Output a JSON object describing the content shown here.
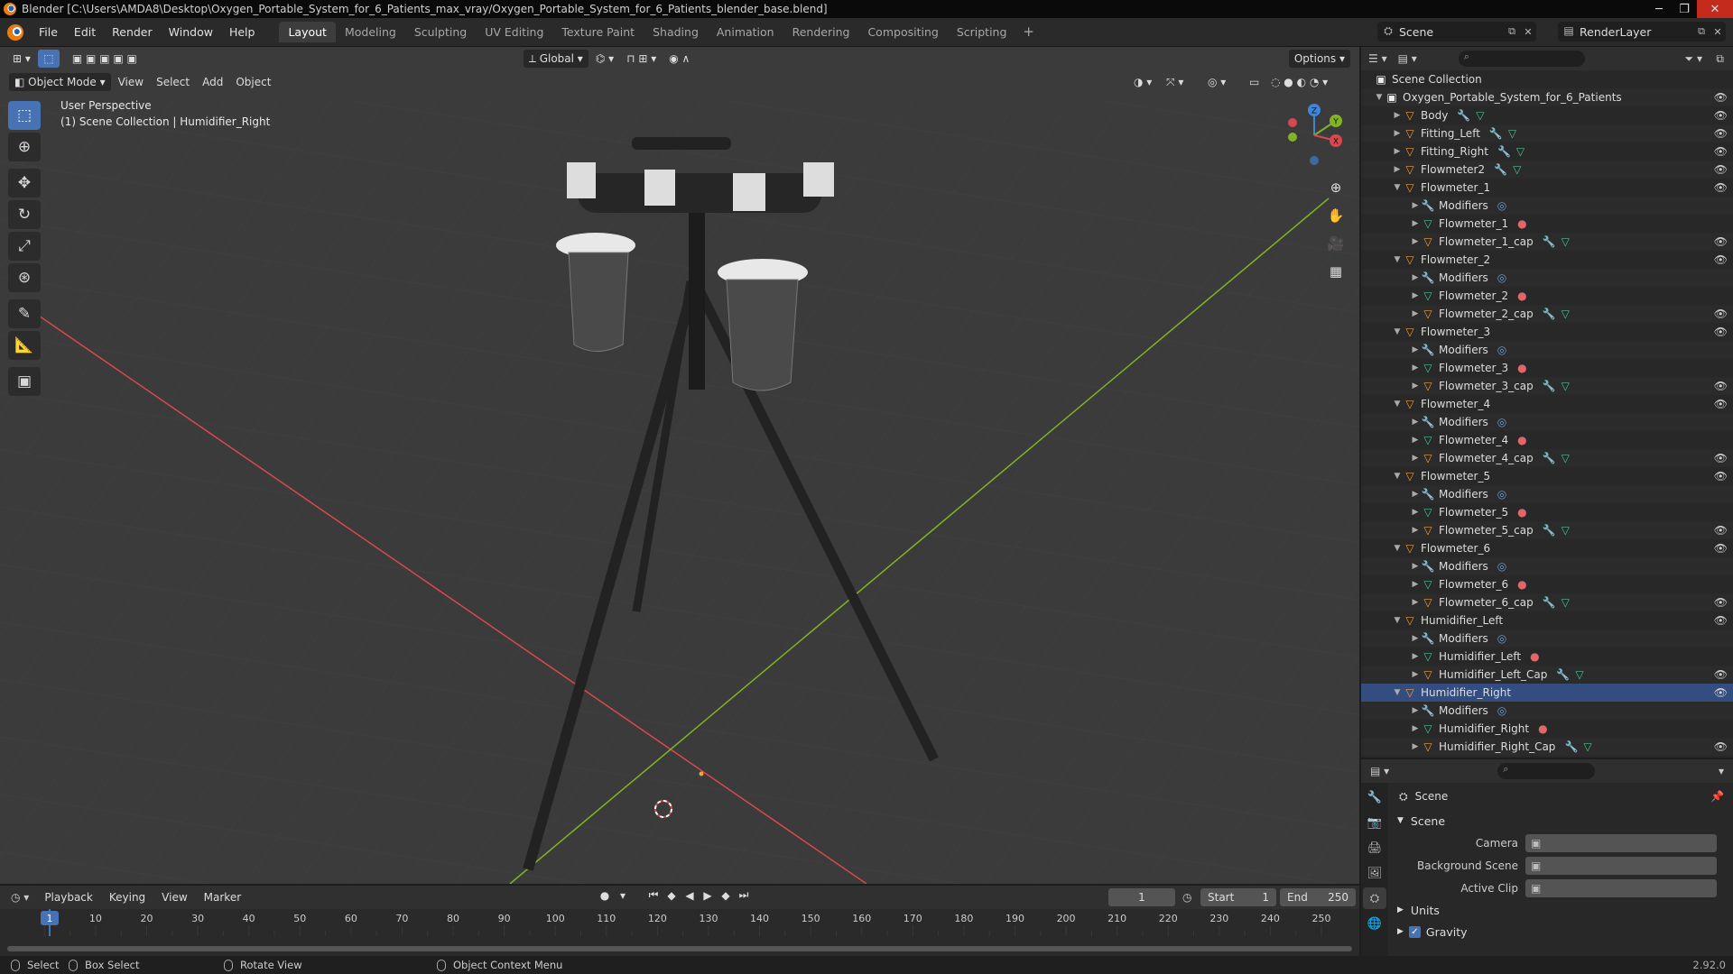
{
  "window": {
    "title": "Blender [C:\\Users\\AMDA8\\Desktop\\Oxygen_Portable_System_for_6_Patients_max_vray/Oxygen_Portable_System_for_6_Patients_blender_base.blend]"
  },
  "menubar": {
    "items": [
      "File",
      "Edit",
      "Render",
      "Window",
      "Help"
    ],
    "workspaces": [
      "Layout",
      "Modeling",
      "Sculpting",
      "UV Editing",
      "Texture Paint",
      "Shading",
      "Animation",
      "Rendering",
      "Compositing",
      "Scripting"
    ],
    "active_workspace": "Layout",
    "scene": "Scene",
    "view_layer": "RenderLayer"
  },
  "viewport": {
    "mode": "Object Mode",
    "menus": [
      "View",
      "Select",
      "Add",
      "Object"
    ],
    "transform_orientation": "Global",
    "options_label": "Options",
    "info_line1": "User Perspective",
    "info_line2": "(1) Scene Collection | Humidifier_Right",
    "gizmo_axes": {
      "x": "X",
      "y": "Y",
      "z": "Z"
    }
  },
  "outliner": {
    "root": "Scene Collection",
    "rows": [
      {
        "depth": 1,
        "type": "coll",
        "label": "Oxygen_Portable_System_for_6_Patients",
        "open": true,
        "eye": true
      },
      {
        "depth": 2,
        "type": "obj",
        "label": "Body",
        "extra": "wt",
        "eye": true
      },
      {
        "depth": 2,
        "type": "obj",
        "label": "Fitting_Left",
        "extra": "wt",
        "eye": true
      },
      {
        "depth": 2,
        "type": "obj",
        "label": "Fitting_Right",
        "extra": "wt",
        "eye": true
      },
      {
        "depth": 2,
        "type": "obj",
        "label": "Flowmeter2",
        "extra": "wt",
        "eye": true
      },
      {
        "depth": 2,
        "type": "obj",
        "label": "Flowmeter_1",
        "open": true,
        "eye": true
      },
      {
        "depth": 3,
        "type": "mod",
        "label": "Modifiers",
        "extra": "ring"
      },
      {
        "depth": 3,
        "type": "mesh",
        "label": "Flowmeter_1",
        "extra": "mat"
      },
      {
        "depth": 3,
        "type": "obj",
        "label": "Flowmeter_1_cap",
        "extra": "wt",
        "eye": true
      },
      {
        "depth": 2,
        "type": "obj",
        "label": "Flowmeter_2",
        "open": true,
        "eye": true
      },
      {
        "depth": 3,
        "type": "mod",
        "label": "Modifiers",
        "extra": "ring"
      },
      {
        "depth": 3,
        "type": "mesh",
        "label": "Flowmeter_2",
        "extra": "mat"
      },
      {
        "depth": 3,
        "type": "obj",
        "label": "Flowmeter_2_cap",
        "extra": "wt",
        "eye": true
      },
      {
        "depth": 2,
        "type": "obj",
        "label": "Flowmeter_3",
        "open": true,
        "eye": true
      },
      {
        "depth": 3,
        "type": "mod",
        "label": "Modifiers",
        "extra": "ring"
      },
      {
        "depth": 3,
        "type": "mesh",
        "label": "Flowmeter_3",
        "extra": "mat"
      },
      {
        "depth": 3,
        "type": "obj",
        "label": "Flowmeter_3_cap",
        "extra": "wt",
        "eye": true
      },
      {
        "depth": 2,
        "type": "obj",
        "label": "Flowmeter_4",
        "open": true,
        "eye": true
      },
      {
        "depth": 3,
        "type": "mod",
        "label": "Modifiers",
        "extra": "ring"
      },
      {
        "depth": 3,
        "type": "mesh",
        "label": "Flowmeter_4",
        "extra": "mat"
      },
      {
        "depth": 3,
        "type": "obj",
        "label": "Flowmeter_4_cap",
        "extra": "wt",
        "eye": true
      },
      {
        "depth": 2,
        "type": "obj",
        "label": "Flowmeter_5",
        "open": true,
        "eye": true
      },
      {
        "depth": 3,
        "type": "mod",
        "label": "Modifiers",
        "extra": "ring"
      },
      {
        "depth": 3,
        "type": "mesh",
        "label": "Flowmeter_5",
        "extra": "mat"
      },
      {
        "depth": 3,
        "type": "obj",
        "label": "Flowmeter_5_cap",
        "extra": "wt",
        "eye": true
      },
      {
        "depth": 2,
        "type": "obj",
        "label": "Flowmeter_6",
        "open": true,
        "eye": true
      },
      {
        "depth": 3,
        "type": "mod",
        "label": "Modifiers",
        "extra": "ring"
      },
      {
        "depth": 3,
        "type": "mesh",
        "label": "Flowmeter_6",
        "extra": "mat"
      },
      {
        "depth": 3,
        "type": "obj",
        "label": "Flowmeter_6_cap",
        "extra": "wt",
        "eye": true
      },
      {
        "depth": 2,
        "type": "obj",
        "label": "Humidifier_Left",
        "open": true,
        "eye": true
      },
      {
        "depth": 3,
        "type": "mod",
        "label": "Modifiers",
        "extra": "ring"
      },
      {
        "depth": 3,
        "type": "mesh",
        "label": "Humidifier_Left",
        "extra": "mat"
      },
      {
        "depth": 3,
        "type": "obj",
        "label": "Humidifier_Left_Cap",
        "extra": "wt",
        "eye": true
      },
      {
        "depth": 2,
        "type": "obj",
        "label": "Humidifier_Right",
        "open": true,
        "eye": true,
        "selected": true
      },
      {
        "depth": 3,
        "type": "mod",
        "label": "Modifiers",
        "extra": "ring"
      },
      {
        "depth": 3,
        "type": "mesh",
        "label": "Humidifier_Right",
        "extra": "mat"
      },
      {
        "depth": 3,
        "type": "obj",
        "label": "Humidifier_Right_Cap",
        "extra": "wt",
        "eye": true
      }
    ]
  },
  "properties": {
    "context": "Scene",
    "panel": "Scene",
    "fields": [
      {
        "label": "Camera",
        "value": ""
      },
      {
        "label": "Background Scene",
        "value": ""
      },
      {
        "label": "Active Clip",
        "value": ""
      }
    ],
    "collapsed_panels": [
      "Units"
    ],
    "gravity_label": "Gravity",
    "gravity_checked": true
  },
  "timeline": {
    "menus": [
      "Playback",
      "Keying",
      "View",
      "Marker"
    ],
    "current_frame": "1",
    "start_label": "Start",
    "start": "1",
    "end_label": "End",
    "end": "250",
    "ticks": [
      "10",
      "20",
      "30",
      "40",
      "50",
      "60",
      "70",
      "80",
      "90",
      "100",
      "110",
      "120",
      "130",
      "140",
      "150",
      "160",
      "170",
      "180",
      "190",
      "200",
      "210",
      "220",
      "230",
      "240",
      "250"
    ],
    "playhead_label": "1"
  },
  "statusbar": {
    "select": "Select",
    "box_select": "Box Select",
    "rotate_view": "Rotate View",
    "context_menu": "Object Context Menu",
    "version": "2.92.0"
  },
  "colors": {
    "accent": "#4772b3",
    "object_icon": "#f29b39",
    "mesh_icon": "#49c08d",
    "modifier_icon": "#6c9bd1",
    "x_axis": "#d8484f",
    "y_axis": "#82b324",
    "z_axis": "#3f86d6"
  }
}
